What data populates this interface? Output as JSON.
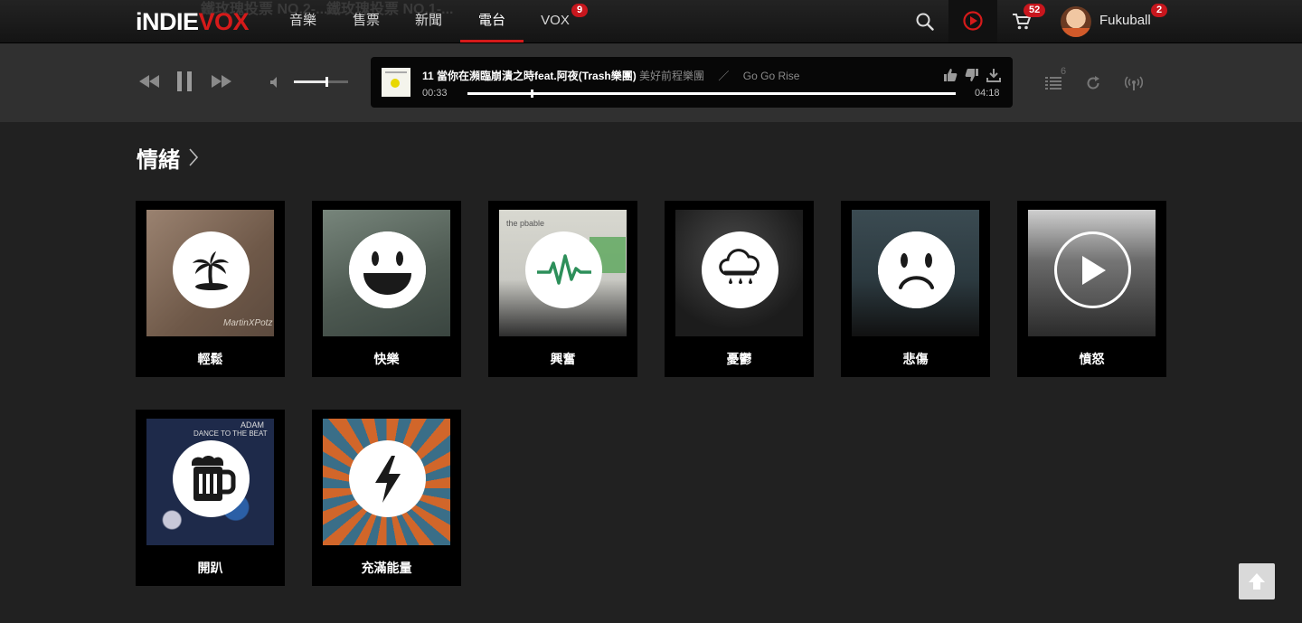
{
  "nav": {
    "logo_white": "iNDIE",
    "logo_red": "VOX",
    "ghost_left": "鐵玫瑰投票 NO.2-...",
    "ghost_right": "鐵玫瑰投票 NO.1-...",
    "items": [
      {
        "label": "音樂"
      },
      {
        "label": "售票"
      },
      {
        "label": "新聞"
      },
      {
        "label": "電台"
      },
      {
        "label": "VOX"
      }
    ],
    "active": "電台",
    "vox_badge": "9",
    "cart_badge": "52",
    "user_badge": "2",
    "username": "Fukuball",
    "icons": [
      "search-icon",
      "play-circle-icon",
      "cart-icon"
    ]
  },
  "player": {
    "track_title": "11 當你在瀕臨崩潰之時feat.阿夜(Trash樂團)",
    "artist": "美好前程樂團",
    "separator": "／",
    "album": "Go Go Rise",
    "elapsed": "00:33",
    "duration": "04:18",
    "progress": 0.13,
    "volume": 0.6,
    "queue_count": "6",
    "icons": [
      "rewind-icon",
      "pause-icon",
      "fast-forward-icon",
      "volume-icon",
      "thumbs-up-icon",
      "thumbs-down-icon",
      "download-icon",
      "queue-list-icon",
      "repeat-icon",
      "broadcast-icon"
    ]
  },
  "section": {
    "title": "情緒"
  },
  "moods": [
    {
      "label": "輕鬆",
      "icon": "palm-island-icon",
      "art_color": "#8a715f"
    },
    {
      "label": "快樂",
      "icon": "smile-icon",
      "art_color": "#5d6b63"
    },
    {
      "label": "興奮",
      "icon": "heartbeat-icon",
      "art_color": "#c9c9c3"
    },
    {
      "label": "憂鬱",
      "icon": "rain-cloud-icon",
      "art_color": "#2b2b2b"
    },
    {
      "label": "悲傷",
      "icon": "sad-face-icon",
      "art_color": "#2c3a40"
    },
    {
      "label": "憤怒",
      "icon": "play-icon",
      "art_color": "#5a5a5a"
    },
    {
      "label": "開趴",
      "icon": "beer-mug-icon",
      "art_color": "#1e2a4a"
    },
    {
      "label": "充滿能量",
      "icon": "lightning-icon",
      "art_color": "#3a6e88"
    }
  ],
  "colors": {
    "brand_red": "#d51a1a",
    "badge_red": "#c8161d",
    "background": "#212121",
    "playerbar": "#303030"
  }
}
